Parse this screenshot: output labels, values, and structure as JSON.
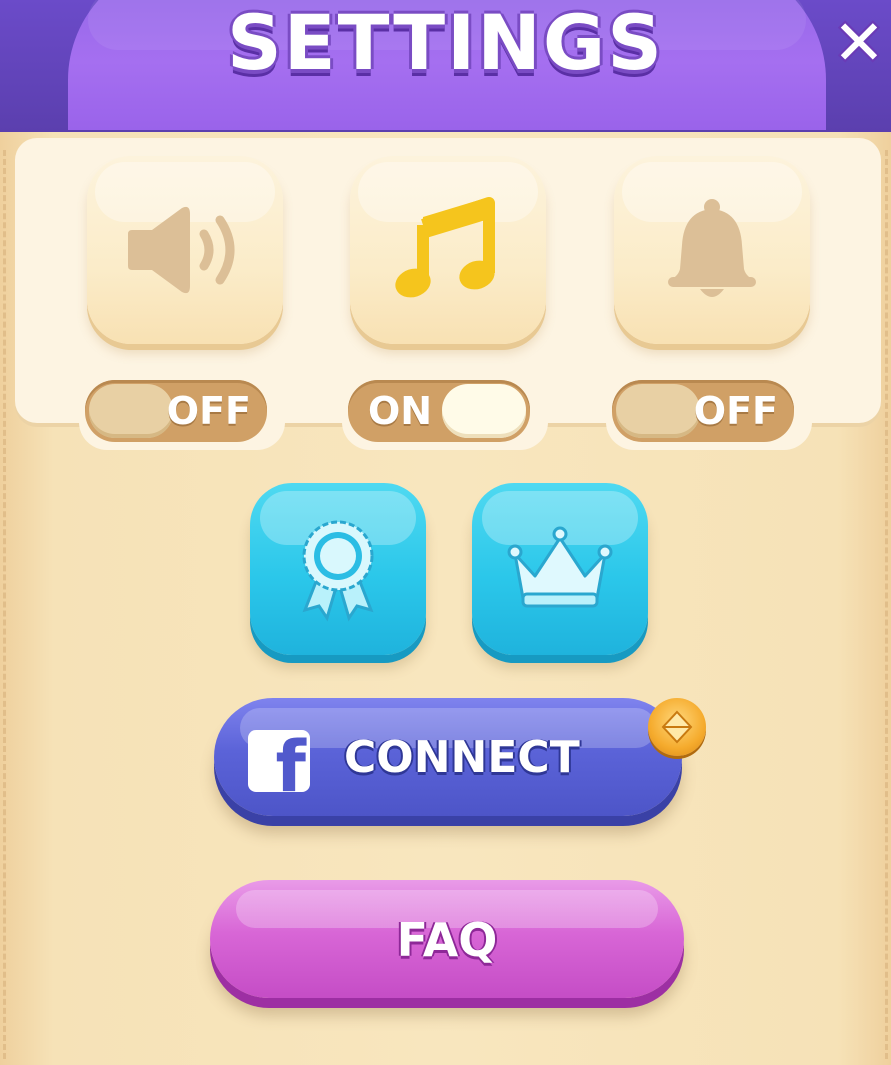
{
  "header": {
    "title": "SETTINGS",
    "close_label": "✕"
  },
  "toggles": [
    {
      "id": "sound",
      "icon": "speaker-icon",
      "state": "OFF",
      "is_on": false
    },
    {
      "id": "music",
      "icon": "music-note-icon",
      "state": "ON",
      "is_on": true
    },
    {
      "id": "notifications",
      "icon": "bell-icon",
      "state": "OFF",
      "is_on": false
    }
  ],
  "buttons": {
    "achievements_icon": "ribbon-award-icon",
    "leaderboard_icon": "crown-icon",
    "connect_label": "CONNECT",
    "connect_icon": "facebook-icon",
    "connect_reward_icon": "gem-coin-icon",
    "faq_label": "FAQ"
  },
  "colors": {
    "header": "#8f66e6",
    "panel": "#f8e6be",
    "toggle_track": "#d0a066",
    "blue_button": "#2bc7ea",
    "connect_button": "#5b63d8",
    "faq_button": "#d866d6",
    "music_icon": "#f5c51d",
    "inactive_icon": "#dcbf97"
  }
}
